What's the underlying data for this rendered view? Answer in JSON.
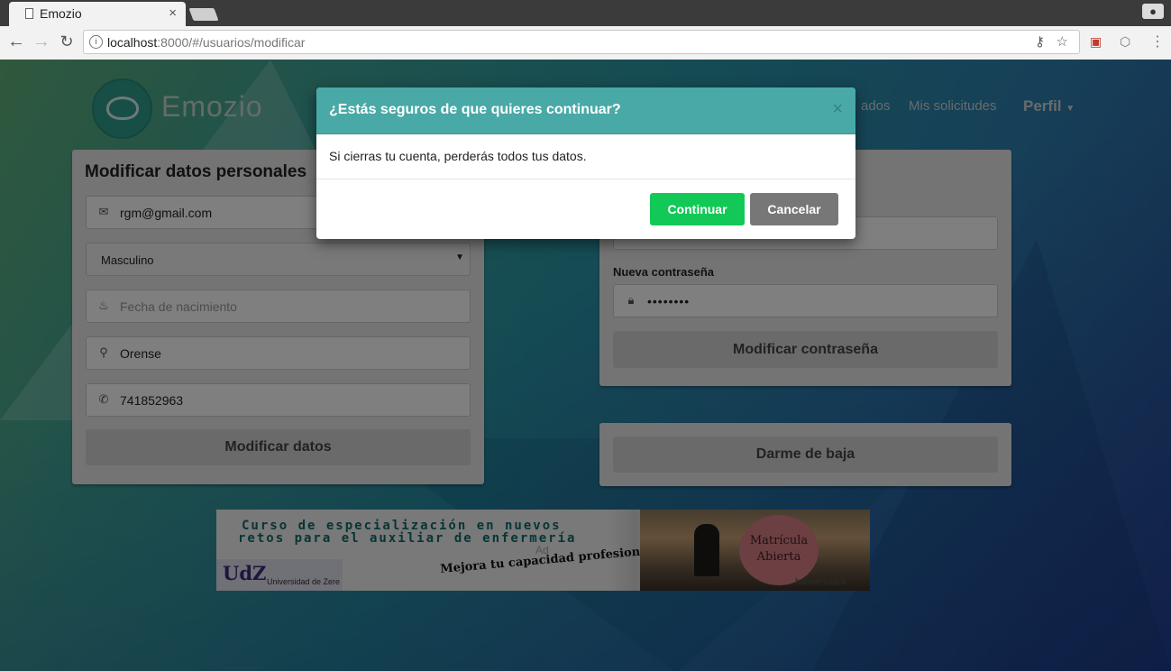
{
  "browser": {
    "tab_title": "Emozio",
    "tab_close": "×",
    "url_host": "localhost",
    "url_rest": ":8000/#/usuarios/modificar"
  },
  "navbar": {
    "brand": "Emozio",
    "links": [
      "ados",
      "Mis solicitudes"
    ],
    "profile": "Perfil"
  },
  "personal": {
    "title": "Modificar datos personales",
    "email": "rgm@gmail.com",
    "gender": "Masculino",
    "birthdate_placeholder": "Fecha de nacimiento",
    "city": "Orense",
    "phone": "741852963",
    "submit": "Modificar datos"
  },
  "password": {
    "new_label": "Nueva contraseña",
    "new_value": "••••••••",
    "submit": "Modificar contraseña"
  },
  "unsubscribe": {
    "button": "Darme de baja"
  },
  "ad": {
    "line1": "Curso de especialización en nuevos",
    "line2": "retos para el auxiliar de enfermería",
    "tag": "Ad",
    "udz": "UdZ",
    "udz_name": "Universidad de Zere",
    "slogan": "Mejora tu capacidad profesional !!",
    "seal_line1": "Matrícula",
    "seal_line2": "Abierta",
    "brand": "bannersnack"
  },
  "modal": {
    "title": "¿Estás seguros de que quieres continuar?",
    "close": "×",
    "body": "Si cierras tu cuenta, perderás todos tus datos.",
    "confirm": "Continuar",
    "cancel": "Cancelar"
  },
  "colors": {
    "modal_header": "#48a9a6",
    "confirm_button": "#12c957",
    "cancel_button": "#777777"
  }
}
